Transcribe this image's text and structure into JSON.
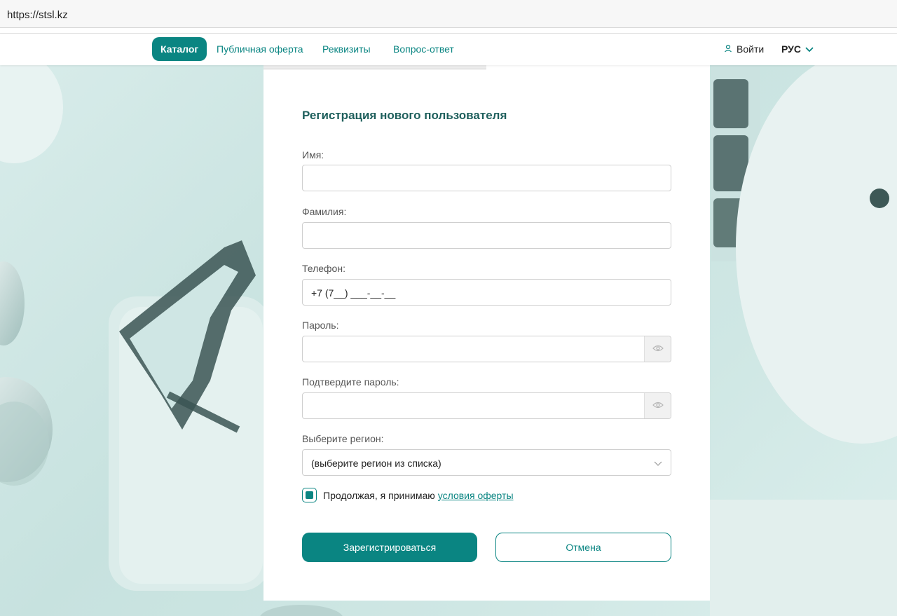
{
  "browser": {
    "url": "https://stsl.kz"
  },
  "nav": {
    "catalog": "Каталог",
    "links": [
      "Публичная оферта",
      "Реквизиты",
      "Вопрос-ответ"
    ],
    "login": "Войти",
    "language": "РУС"
  },
  "form": {
    "title": "Регистрация нового пользователя",
    "first_name_label": "Имя:",
    "first_name_value": "",
    "last_name_label": "Фамилия:",
    "last_name_value": "",
    "phone_label": "Телефон:",
    "phone_value": "+7 (7__) ___-__-__",
    "password_label": "Пароль:",
    "password_value": "",
    "confirm_label": "Подтвердите пароль:",
    "confirm_value": "",
    "region_label": "Выберите регион:",
    "region_value": "(выберите регион из списка)",
    "agree_text": "Продолжая, я принимаю",
    "agree_link": "условия оферты",
    "agree_checked": true,
    "submit": "Зарегистрироваться",
    "cancel": "Отмена"
  },
  "colors": {
    "accent": "#0a8582",
    "title": "#1e5f5c"
  },
  "icons": [
    "user-icon",
    "chevron-down-icon",
    "eye-icon",
    "checkbox-checked-icon"
  ]
}
